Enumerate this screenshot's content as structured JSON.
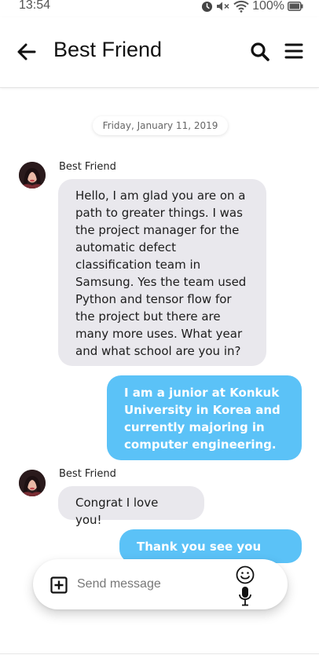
{
  "status_bar": {
    "time": "13:54",
    "battery_percent": "100%",
    "icons": [
      "alarm-icon",
      "mute-icon",
      "wifi-icon",
      "battery-icon"
    ]
  },
  "header": {
    "title": "Best Friend",
    "icons": [
      "back-arrow-icon",
      "search-icon",
      "menu-icon"
    ]
  },
  "date_separator": "Friday, January 11, 2019",
  "messages": [
    {
      "direction": "incoming",
      "sender": "Best Friend",
      "lines": [
        "Hello, I am glad you are on a",
        "path to greater things. I was",
        "the project manager for the",
        "automatic defect",
        "classification team in",
        "Samsung. Yes the team used",
        "Python and tensor flow for",
        "the project but there are",
        "many more uses. What year",
        "and what school are you in?"
      ]
    },
    {
      "direction": "outgoing",
      "lines": [
        "I am a junior at Konkuk",
        "University in Korea and",
        "currently majoring in",
        "computer engineering."
      ]
    },
    {
      "direction": "incoming",
      "sender": "Best Friend",
      "lines": [
        "Congrat I love you!"
      ]
    },
    {
      "direction": "outgoing",
      "lines": [
        "Thank you see you soon!"
      ]
    }
  ],
  "composer": {
    "placeholder": "Send message",
    "icons": [
      "add-attachment-icon",
      "emoji-icon",
      "microphone-icon"
    ]
  },
  "colors": {
    "incoming_bubble": "#e9e8ed",
    "outgoing_bubble": "#5bc2f7"
  }
}
